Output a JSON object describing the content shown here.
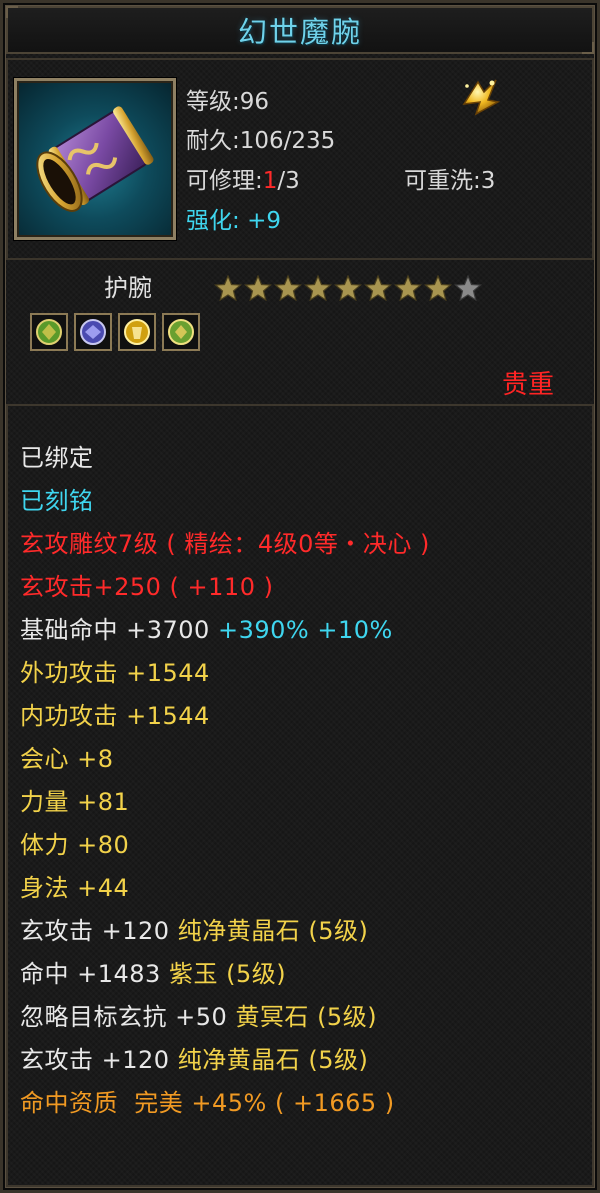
{
  "window": {
    "title": "幻世魔腕"
  },
  "item": {
    "level_label": "等级:",
    "level_value": "96",
    "durability_label": "耐久:",
    "durability_value": "106/235",
    "repair_label": "可修理:",
    "repair_current": "1",
    "repair_rest": "/3",
    "rewash_label": "可重洗:",
    "rewash_value": "3",
    "enhance_label": "强化:",
    "enhance_value": "+9",
    "type": "护腕",
    "stars_filled": 8,
    "stars_total": 9,
    "rarity": "贵重",
    "gem_icons": [
      "green-gem-icon",
      "purple-gem-icon",
      "yellow-gem-icon",
      "green-gem-icon"
    ]
  },
  "attributes": {
    "bound": "已绑定",
    "engraved": "已刻铭",
    "pattern": "玄攻雕纹7级 ( 精绘：4级0等・决心 )",
    "xuan_attack": {
      "label": "玄攻击",
      "value": "+250 ( +110 )"
    },
    "base_hit": {
      "label": "基础命中",
      "value": "+3700",
      "pct1": "+390%",
      "pct2": "+10%"
    },
    "outer_attack": {
      "label": "外功攻击",
      "value": "+1544"
    },
    "inner_attack": {
      "label": "内功攻击",
      "value": "+1544"
    },
    "crit": {
      "label": "会心",
      "value": "+8"
    },
    "strength": {
      "label": "力量",
      "value": "+81"
    },
    "stamina": {
      "label": "体力",
      "value": "+80"
    },
    "agility": {
      "label": "身法",
      "value": "+44"
    },
    "gem1": {
      "label": "玄攻击",
      "value": "+120",
      "gem": "纯净黄晶石 (5级)"
    },
    "gem2": {
      "label": "命中",
      "value": "+1483",
      "gem": "紫玉 (5级)"
    },
    "gem3": {
      "label": "忽略目标玄抗",
      "value": "+50",
      "gem": "黄冥石 (5级)"
    },
    "gem4": {
      "label": "玄攻击",
      "value": "+120",
      "gem": "纯净黄晶石 (5级)"
    },
    "aptitude": {
      "label": "命中资质",
      "quality": "完美",
      "value": "+45%",
      "bonus": "( +1665 )"
    }
  },
  "colors": {
    "title": "#6fd2ea",
    "red": "#ff2a2a",
    "cyan": "#3fd6ef",
    "yellow": "#f2d24a",
    "orange": "#f19a23",
    "star_on": "#a89550",
    "star_off": "#8a8a8a"
  }
}
